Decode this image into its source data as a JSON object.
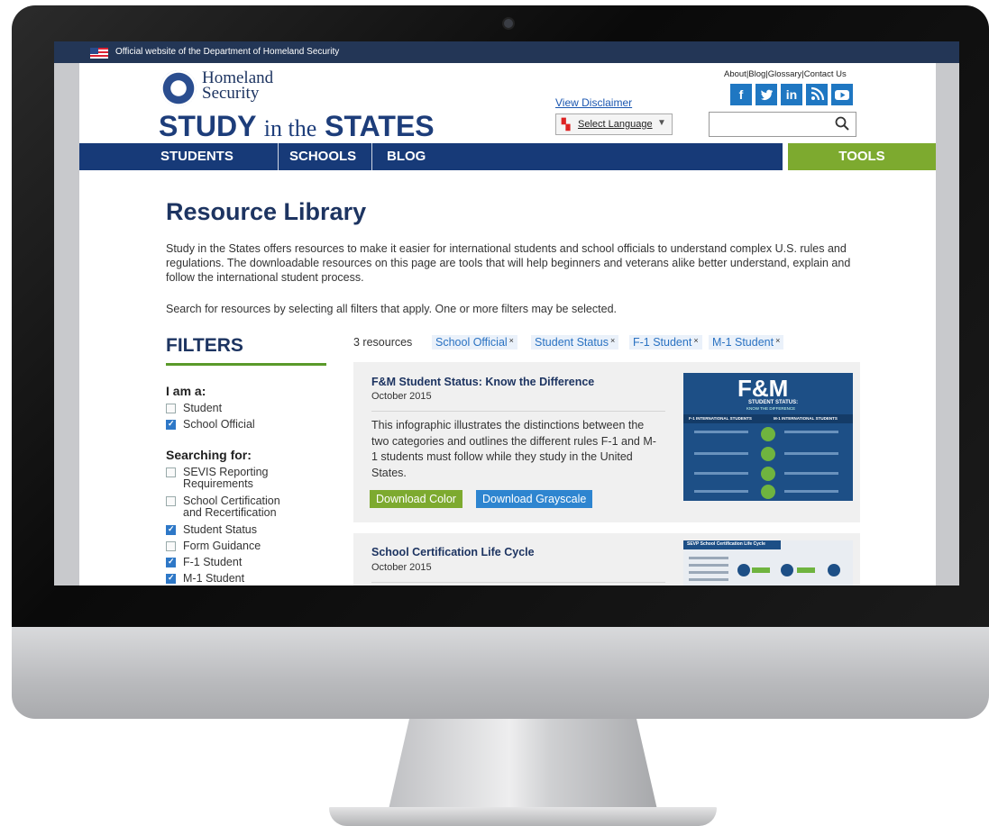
{
  "banner": {
    "text": "Official website of the Department of Homeland Security"
  },
  "logo": {
    "agency_line1": "Homeland",
    "agency_line2": "Security",
    "title_study": "STUDY",
    "title_inthe": "in the",
    "title_states": "STATES"
  },
  "utility_links": [
    "About",
    "Blog",
    "Glossary",
    "Contact Us"
  ],
  "utility_separator": "|",
  "social": [
    "f",
    "t",
    "in",
    "rss",
    "yt"
  ],
  "disclaimer": "View Disclaimer",
  "language": {
    "label": "Select Language"
  },
  "search": {
    "placeholder": ""
  },
  "nav": [
    "STUDENTS",
    "SCHOOLS",
    "BLOG"
  ],
  "nav_tools": "TOOLS",
  "main": {
    "title": "Resource Library",
    "intro": "Study in the States offers resources to make it easier for international students and school officials to understand complex U.S. rules and regulations. The downloadable resources on this page are tools that will help beginners and veterans alike better understand, explain and follow the international student process.",
    "hint": "Search for resources by selecting all filters that apply. One or more filters may be selected."
  },
  "filters": {
    "heading": "FILTERS",
    "groups": [
      {
        "label": "I am a:",
        "options": [
          {
            "label": "Student",
            "checked": false
          },
          {
            "label": "School Official",
            "checked": true
          }
        ]
      },
      {
        "label": "Searching for:",
        "options": [
          {
            "label": "SEVIS Reporting Requirements",
            "checked": false
          },
          {
            "label": "School Certification and Recertification",
            "checked": false
          },
          {
            "label": "Student Status",
            "checked": true
          },
          {
            "label": "Form Guidance",
            "checked": false
          },
          {
            "label": "F-1 Student",
            "checked": true
          },
          {
            "label": "M-1 Student",
            "checked": true
          }
        ]
      }
    ]
  },
  "results": {
    "count": "3 resources",
    "chips": [
      "School Official",
      "Student Status",
      "F-1 Student",
      "M-1 Student"
    ],
    "chip_remove": "×"
  },
  "cards": [
    {
      "title": "F&M Student Status: Know the Difference",
      "date": "October 2015",
      "desc": "This infographic illustrates the distinctions between the two categories and outlines the different rules F-1 and M-1 students must follow while they study in the United States.",
      "btn_color": "Download Color",
      "btn_gray": "Download Grayscale",
      "thumb": {
        "big": "F&M",
        "sub": "STUDENT STATUS:",
        "sub2": "KNOW THE DIFFERENCE",
        "col1": "F-1 INTERNATIONAL STUDENTS",
        "col2": "M-1 INTERNATIONAL STUDENTS"
      }
    },
    {
      "title": "School Certification Life Cycle",
      "date": "October 2015",
      "thumb": {
        "big": "SEVP School Certification Life Cycle"
      }
    }
  ],
  "colors": {
    "navy": "#173a78",
    "green": "#7daa2f",
    "link": "#2a72c2"
  }
}
